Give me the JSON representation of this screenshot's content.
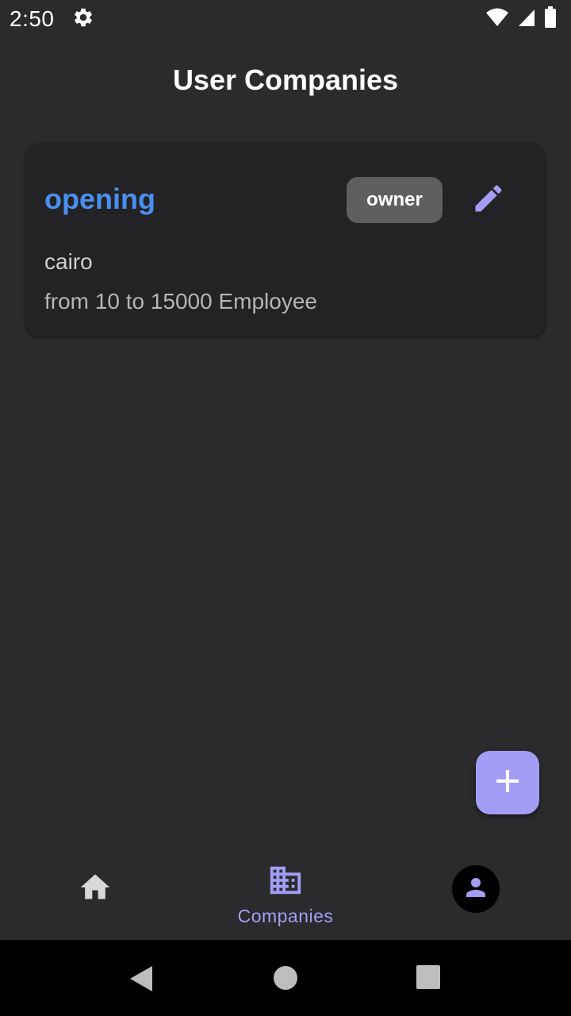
{
  "status_bar": {
    "time": "2:50",
    "icons": [
      "gear-icon",
      "wifi-icon",
      "cell-signal-icon",
      "battery-icon"
    ]
  },
  "app_bar": {
    "title": "User Companies"
  },
  "companies": [
    {
      "name": "opening",
      "role": "owner",
      "location": "cairo",
      "size": "from 10 to 15000 Employee",
      "edit_icon": "pencil-icon"
    }
  ],
  "fab": {
    "icon": "plus-icon"
  },
  "bottom_nav": {
    "items": [
      {
        "icon": "home-icon",
        "label": ""
      },
      {
        "icon": "building-icon",
        "label": "Companies",
        "active": true
      },
      {
        "icon": "person-icon",
        "label": ""
      }
    ]
  },
  "system_nav": {
    "icons": [
      "back-icon",
      "home-circle-icon",
      "recents-icon"
    ]
  },
  "colors": {
    "background": "#2b2b2d",
    "card": "#232325",
    "accent": "#a39ef5",
    "company_name": "#4a8ff0",
    "badge": "#5f5f61"
  }
}
